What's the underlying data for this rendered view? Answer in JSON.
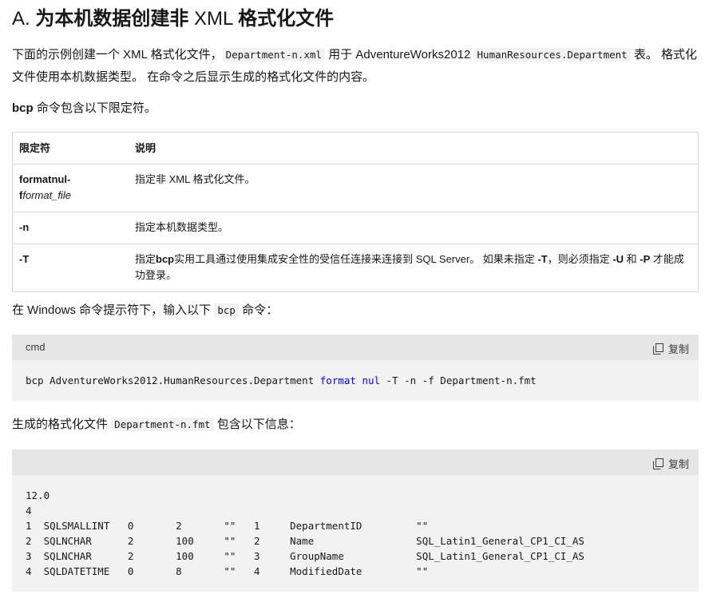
{
  "heading": {
    "prefix": "A. ",
    "part1": "为本机数据创建非",
    "middle": " XML ",
    "part2": "格式化文件"
  },
  "intro": {
    "t1": "下面的示例创建一个 XML 格式化文件，",
    "code1": "Department-n.xml",
    "t2": " 用于 AdventureWorks2012 ",
    "code2": "HumanResources.Department",
    "t3": " 表。 格式化文件使用本机数据类型。 在命令之后显示生成的格式化文件的内容。"
  },
  "qualifier_intro": {
    "bold": "bcp",
    "rest": " 命令包含以下限定符。"
  },
  "table": {
    "headers": [
      "限定符",
      "说明"
    ],
    "rows": [
      {
        "q1": "formatnul-",
        "q2": "f",
        "q3": "format_file",
        "desc": "指定非 XML 格式化文件。"
      },
      {
        "q1": "-n",
        "desc": "指定本机数据类型。"
      },
      {
        "q1": "-T",
        "d1": "指定",
        "d2": "bcp",
        "d3": "实用工具通过使用集成安全性的受信任连接来连接到 SQL Server。 如果未指定 ",
        "d4": "-T",
        "d5": "，则必须指定 ",
        "d6": "-U",
        "d7": " 和 ",
        "d8": "-P",
        "d9": " 才能成功登录。"
      }
    ]
  },
  "cmd_intro": {
    "t1": "在 Windows 命令提示符下，输入以下 ",
    "code": "bcp",
    "t2": " 命令："
  },
  "code1": {
    "lang": "cmd",
    "copy_label": "复制",
    "part1": "bcp AdventureWorks2012.HumanResources.Department ",
    "kw1": "format",
    "space": " ",
    "kw2": "nul",
    "part2": " -T -n -f Department-n.fmt"
  },
  "result_intro": {
    "t1": "生成的格式化文件 ",
    "code": "Department-n.fmt",
    "t2": " 包含以下信息："
  },
  "code2": {
    "copy_label": "复制",
    "content": "12.0\n4\n1  SQLSMALLINT   0       2       \"\"   1     DepartmentID         \"\"\n2  SQLNCHAR      2       100     \"\"   2     Name                 SQL_Latin1_General_CP1_CI_AS\n3  SQLNCHAR      2       100     \"\"   3     GroupName            SQL_Latin1_General_CP1_CI_AS\n4  SQLDATETIME   0       8       \"\"   4     ModifiedDate         \"\""
  }
}
